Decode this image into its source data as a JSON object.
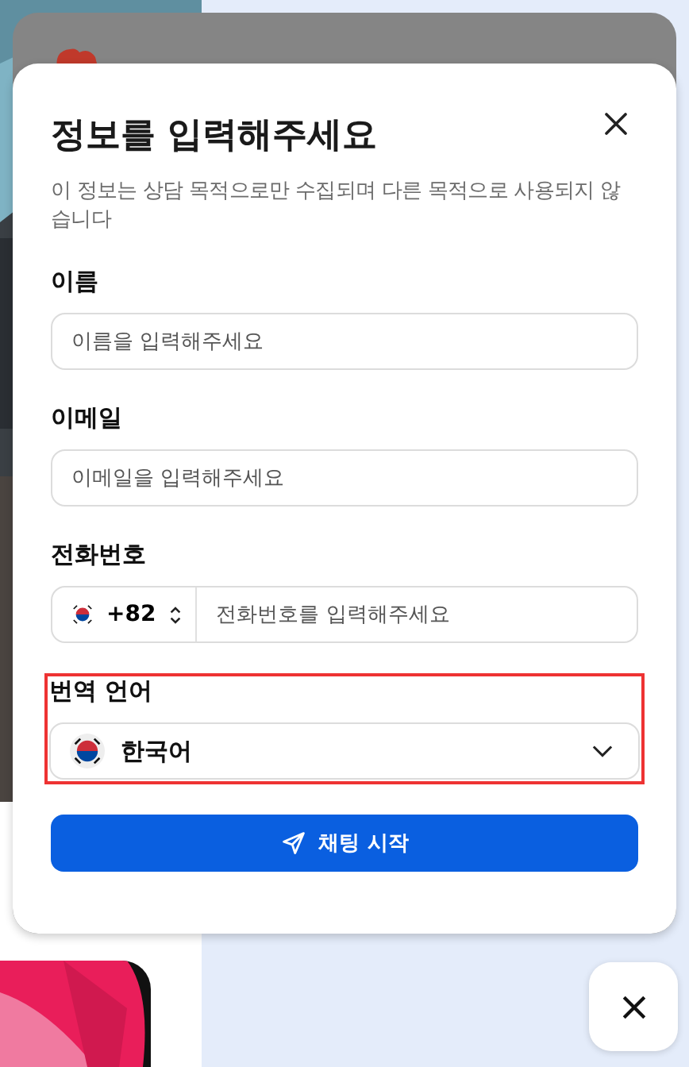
{
  "modal": {
    "title": "정보를 입력해주세요",
    "subtitle": "이 정보는 상담 목적으로만 수집되며 다른 목적으로 사용되지 않습니다",
    "fields": [
      {
        "kind": "text",
        "label": "이름",
        "placeholder": "이름을 입력해주세요",
        "highlighted": false
      },
      {
        "kind": "text",
        "label": "이메일",
        "placeholder": "이메일을 입력해주세요",
        "highlighted": false
      },
      {
        "kind": "phone",
        "label": "전화번호",
        "country_code": "+82",
        "placeholder": "전화번호를 입력해주세요",
        "highlighted": false
      },
      {
        "kind": "select",
        "label": "번역 언어",
        "value": "한국어",
        "highlighted": true
      }
    ],
    "submit_button": "채팅 시작"
  }
}
